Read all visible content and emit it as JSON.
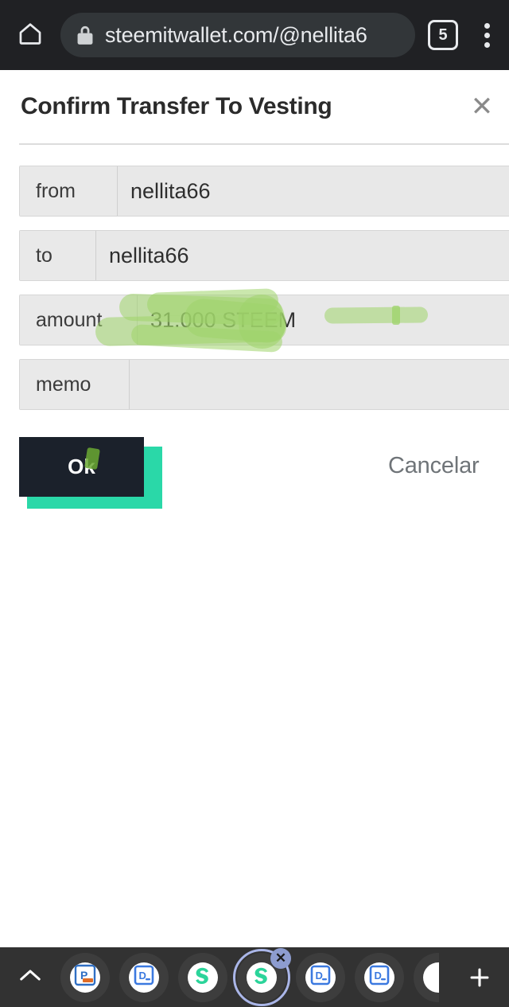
{
  "browser": {
    "home_icon": "home-icon",
    "lock_icon": "lock-icon",
    "url": "steemitwallet.com/@nellita6",
    "tab_count": "5",
    "menu_icon": "overflow-menu-icon"
  },
  "dialog": {
    "title": "Confirm Transfer To Vesting",
    "close_label": "✕",
    "fields": [
      {
        "label": "from",
        "value": "nellita66"
      },
      {
        "label": "to",
        "value": "nellita66"
      },
      {
        "label": "amount",
        "value": "31.000 STEEM"
      },
      {
        "label": "memo",
        "value": ""
      }
    ],
    "ok_label": "Ok",
    "cancel_label": "Cancelar"
  },
  "annotations": {
    "type": "green-highlighter",
    "color": "#9ed36a",
    "targets": [
      "amount-value",
      "ok-button"
    ],
    "note": "hand-drawn marker strokes over the amount row and a small mark on Ok"
  },
  "tabstrip": {
    "expand_icon": "chevron-up-icon",
    "add_label": "+",
    "tabs": [
      {
        "name": "powerpoint-tab",
        "icon": "powerpoint-icon",
        "active": false
      },
      {
        "name": "docs-tab-1",
        "icon": "docs-icon",
        "active": false
      },
      {
        "name": "steemit-tab-1",
        "icon": "steem-icon",
        "active": false
      },
      {
        "name": "steemit-tab-2",
        "icon": "steem-icon",
        "active": true
      },
      {
        "name": "docs-tab-2",
        "icon": "docs-icon",
        "active": false
      },
      {
        "name": "docs-tab-3",
        "icon": "docs-icon",
        "active": false
      }
    ],
    "close_badge": "✕"
  },
  "colors": {
    "chrome_bg": "#202124",
    "omnibox_bg": "#323639",
    "field_bg": "#e8e8e8",
    "ok_bg": "#1b212b",
    "ok_shadow": "#2ad8a8",
    "highlighter": "#9ed36a",
    "tabstrip_bg": "#323232",
    "accent_ring": "#aab6e8"
  }
}
